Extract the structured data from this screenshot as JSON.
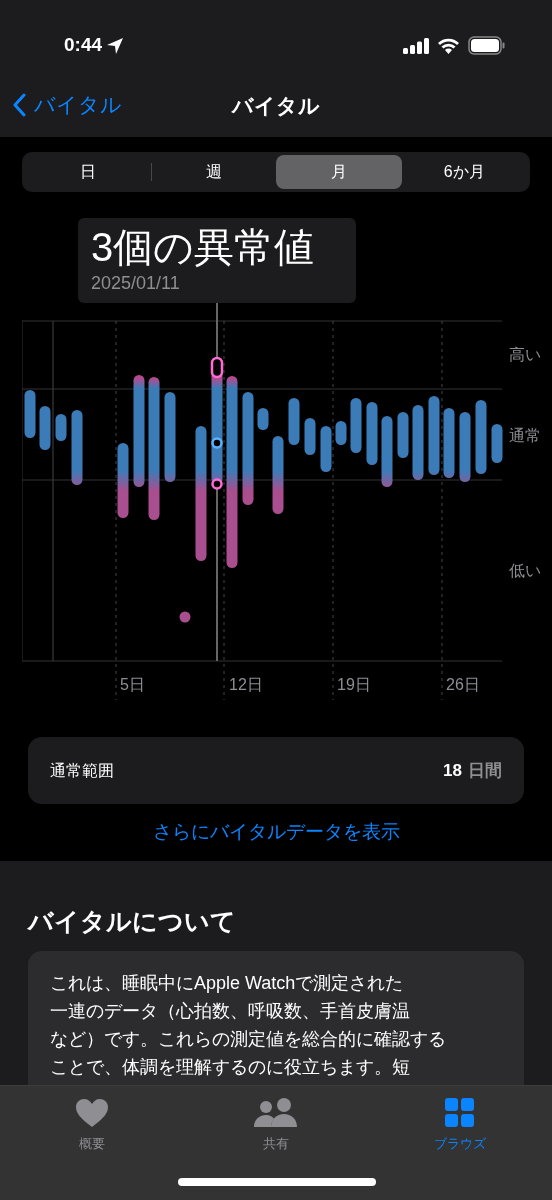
{
  "status_bar": {
    "time": "0:44"
  },
  "nav": {
    "back": "バイタル",
    "title": "バイタル"
  },
  "segments": [
    {
      "label": "日",
      "selected": false
    },
    {
      "label": "週",
      "selected": false
    },
    {
      "label": "月",
      "selected": true
    },
    {
      "label": "6か月",
      "selected": false
    }
  ],
  "tooltip": {
    "title": "3個の異常値",
    "date": "2025/01/11"
  },
  "chart": {
    "y_labels": [
      "高い",
      "通常",
      "低い"
    ],
    "x_labels": [
      "5日",
      "12日",
      "19日",
      "26日"
    ]
  },
  "summary": {
    "label": "通常範囲",
    "value": "18",
    "unit": "日間"
  },
  "more_link": "さらにバイタルデータを表示",
  "about": {
    "heading": "バイタルについて",
    "lines": [
      "これは、睡眠中にApple Watchで測定された",
      "一連のデータ（心拍数、呼吸数、手首皮膚温",
      "など）です。これらの測定値を総合的に確認する",
      "ことで、体調を理解するのに役立ちます。短"
    ]
  },
  "tab_bar": [
    {
      "kind": "heart",
      "label": "概要",
      "selected": false
    },
    {
      "kind": "people",
      "label": "共有",
      "selected": false
    },
    {
      "kind": "grid",
      "label": "ブラウズ",
      "selected": true
    }
  ]
}
